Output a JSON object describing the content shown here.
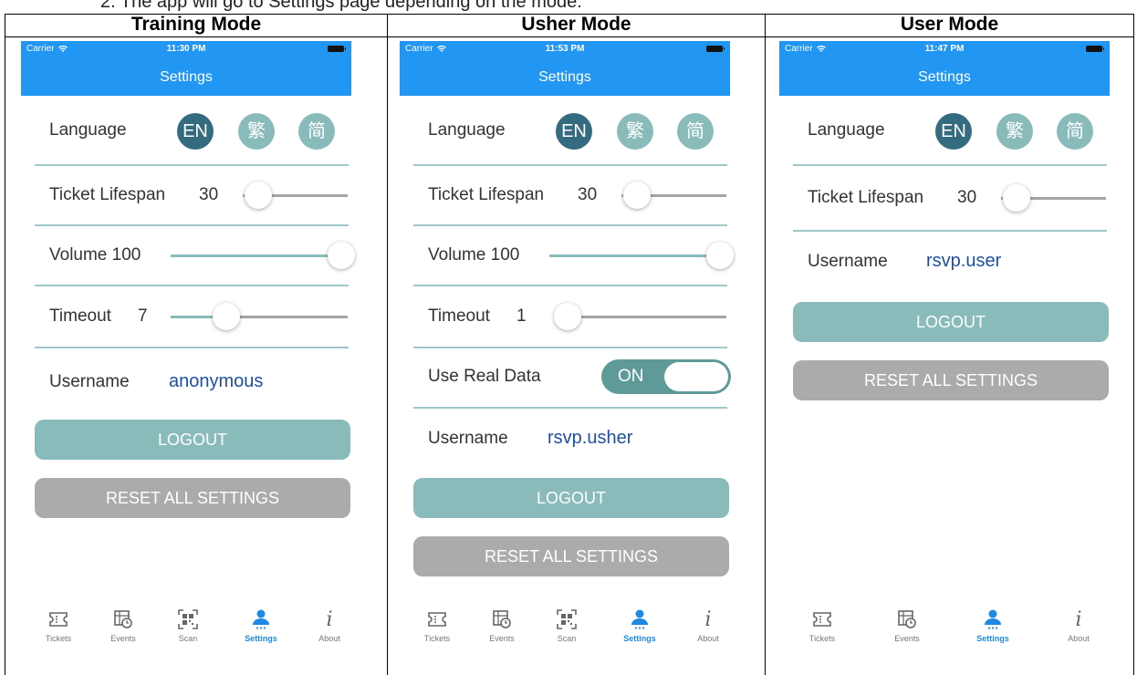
{
  "caption": "2.    The app will go to Settings page depending on the mode:",
  "columns": [
    "Training Mode",
    "Usher Mode",
    "User Mode"
  ],
  "status": {
    "carrier": "Carrier",
    "times": [
      "11:30 PM",
      "11:53 PM",
      "11:47 PM"
    ]
  },
  "settings_title": "Settings",
  "labels": {
    "language": "Language",
    "ticket_lifespan": "Ticket Lifespan",
    "volume": "Volume",
    "timeout": "Timeout",
    "use_real_data": "Use Real Data",
    "username": "Username",
    "logout": "LOGOUT",
    "reset": "RESET ALL SETTINGS"
  },
  "languages": [
    "EN",
    "繁",
    "简"
  ],
  "selected_language": "EN",
  "training": {
    "ticket_lifespan": "30",
    "ticket_lifespan_level": 0.1,
    "volume": "100",
    "volume_level": 1.0,
    "timeout": "7",
    "timeout_level": 0.3,
    "username": "anonymous"
  },
  "usher": {
    "ticket_lifespan": "30",
    "ticket_lifespan_level": 0.1,
    "volume": "100",
    "volume_level": 1.0,
    "timeout": "1",
    "timeout_level": 0.0,
    "use_real_data": "ON",
    "username": "rsvp.usher"
  },
  "user": {
    "ticket_lifespan": "30",
    "ticket_lifespan_level": 0.1,
    "username": "rsvp.user"
  },
  "tabs": {
    "tickets": "Tickets",
    "events": "Events",
    "scan": "Scan",
    "settings": "Settings",
    "about": "About"
  },
  "colors": {
    "nav": "#2196f3",
    "accent_teal": "#8abbbb",
    "selected_language": "#356b80",
    "reset_grey": "#ababab",
    "active_tab": "#1e88e5"
  }
}
